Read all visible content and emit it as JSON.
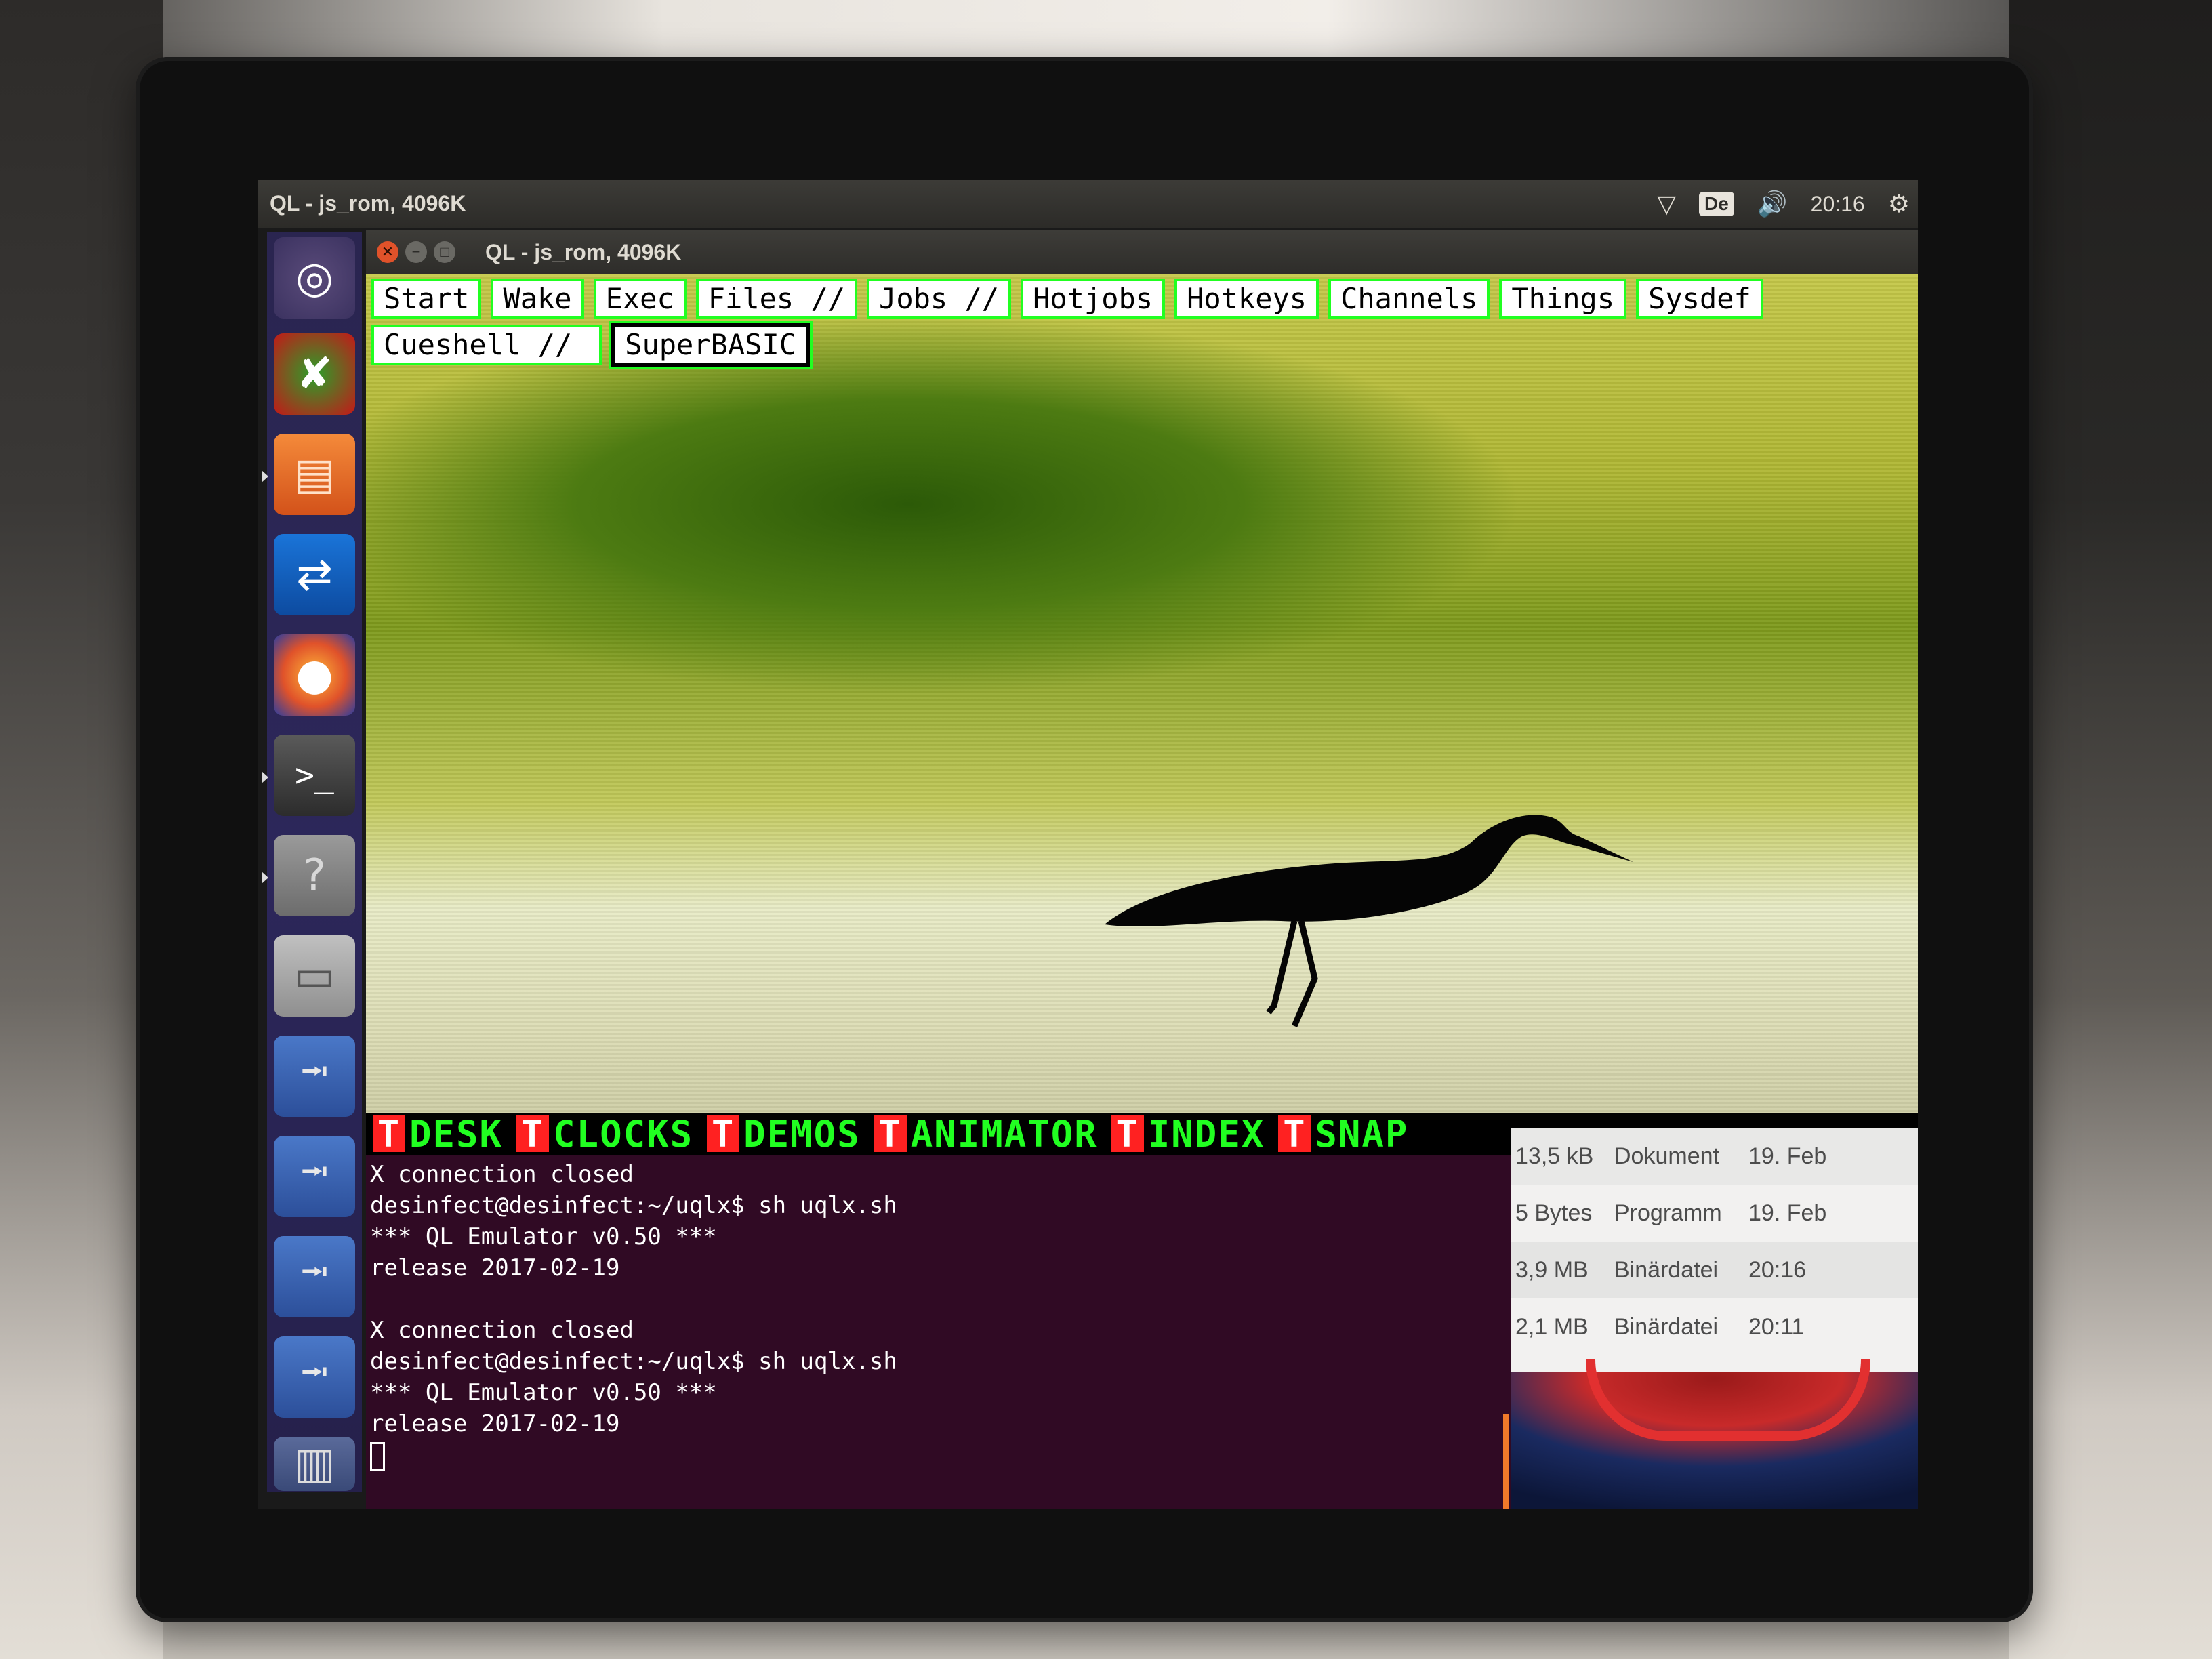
{
  "top_panel": {
    "app_title": "QL - js_rom, 4096K",
    "keyboard_layout": "De",
    "clock": "20:16",
    "icons": [
      "wifi-icon",
      "volume-icon",
      "settings-gear-icon"
    ]
  },
  "launcher": {
    "items": [
      {
        "name": "ubuntu-dash",
        "icon": "ubuntu-logo-icon"
      },
      {
        "name": "desinfect-virus-scanner",
        "icon": "virus-icon"
      },
      {
        "name": "files",
        "icon": "folder-icon"
      },
      {
        "name": "teamviewer",
        "icon": "teamviewer-icon"
      },
      {
        "name": "firefox",
        "icon": "firefox-icon"
      },
      {
        "name": "terminal",
        "icon": "terminal-icon",
        "glyph": ">_"
      },
      {
        "name": "help",
        "icon": "help-icon",
        "glyph": "?"
      },
      {
        "name": "drive",
        "icon": "drive-icon"
      },
      {
        "name": "usb-1",
        "icon": "usb-icon"
      },
      {
        "name": "usb-2",
        "icon": "usb-icon"
      },
      {
        "name": "usb-3",
        "icon": "usb-icon"
      },
      {
        "name": "usb-4",
        "icon": "usb-icon"
      },
      {
        "name": "trash",
        "icon": "trash-icon"
      }
    ]
  },
  "ql_window": {
    "title": "QL - js_rom, 4096K",
    "menu_row1": [
      "Start",
      "Wake",
      "Exec",
      "Files ∕∕",
      "Jobs ∕∕",
      "Hotjobs",
      "Hotkeys",
      "Channels",
      "Things",
      "Sysdef"
    ],
    "menu_row2": [
      "Cueshell ∕∕",
      "SuperBASIC"
    ],
    "bottom_tabs": [
      {
        "t": "T",
        "label": "DESK"
      },
      {
        "t": "T",
        "label": "CLOCKS"
      },
      {
        "t": "T",
        "label": "DEMOS"
      },
      {
        "t": "T",
        "label": "ANIMATOR"
      },
      {
        "t": "T",
        "label": "INDEX"
      },
      {
        "t": "T",
        "label": "SNAP"
      }
    ],
    "colors": {
      "green": "#21ff21",
      "red": "#ff2121",
      "white": "#ffffff"
    }
  },
  "terminal": {
    "lines": [
      "X connection closed",
      "desinfect@desinfect:~/uqlx$ sh uqlx.sh",
      "*** QL Emulator v0.50 ***",
      "release 2017-02-19",
      "",
      "X connection closed",
      "desinfect@desinfect:~/uqlx$ sh uqlx.sh",
      "*** QL Emulator v0.50 ***",
      "release 2017-02-19",
      ""
    ],
    "background": "#300a24"
  },
  "file_manager": {
    "rows": [
      {
        "size": "13,5 kB",
        "type": "Dokument",
        "date": "19. Feb"
      },
      {
        "size": "5 Bytes",
        "type": "Programm",
        "date": "19. Feb"
      },
      {
        "size": "3,9 MB",
        "type": "Binärdatei",
        "date": "20:16"
      },
      {
        "size": "2,1 MB",
        "type": "Binärdatei",
        "date": "20:11"
      }
    ]
  }
}
